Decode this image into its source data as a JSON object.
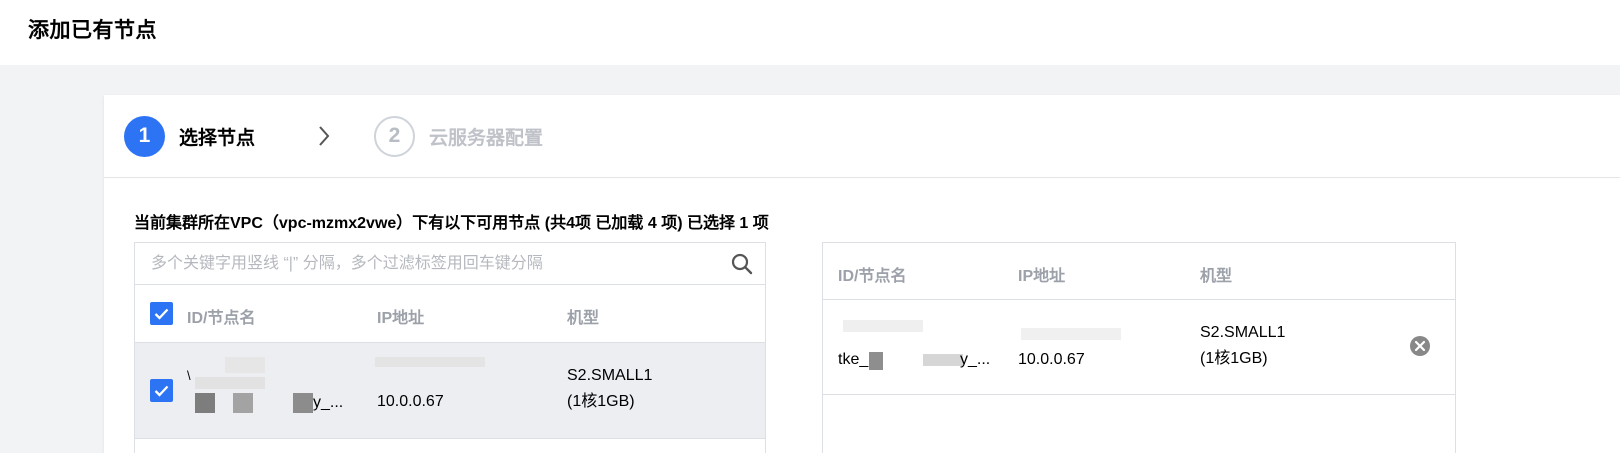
{
  "page": {
    "title": "添加已有节点"
  },
  "steps": [
    {
      "number": "1",
      "label": "选择节点",
      "state": "active"
    },
    {
      "number": "2",
      "label": "云服务器配置",
      "state": "inactive"
    }
  ],
  "summary": "当前集群所在VPC（vpc-mzmx2vwe）下有以下可用节点 (共4项 已加载 4 项) 已选择 1 项",
  "search": {
    "placeholder": "多个关键字用竖线 “|” 分隔，多个过滤标签用回车键分隔"
  },
  "available_table": {
    "columns": [
      "ID/节点名",
      "IP地址",
      "机型"
    ],
    "rows": [
      {
        "checked": true,
        "id_name": "\\",
        "id_name_suffix": "y_...",
        "ip": "10.0.0.67",
        "type_line1": "S2.SMALL1",
        "type_line2": "(1核1GB)"
      }
    ]
  },
  "selected_table": {
    "columns": [
      "ID/节点名",
      "IP地址",
      "机型"
    ],
    "rows": [
      {
        "id_name_prefix": "tke_",
        "id_name_suffix": "y_...",
        "ip": "10.0.0.67",
        "type_line1": "S2.SMALL1",
        "type_line2": "(1核1GB)"
      }
    ]
  },
  "colors": {
    "accent": "#2d74f4",
    "header_text": "#9ca1a9",
    "selected_row": "#eceef2"
  }
}
